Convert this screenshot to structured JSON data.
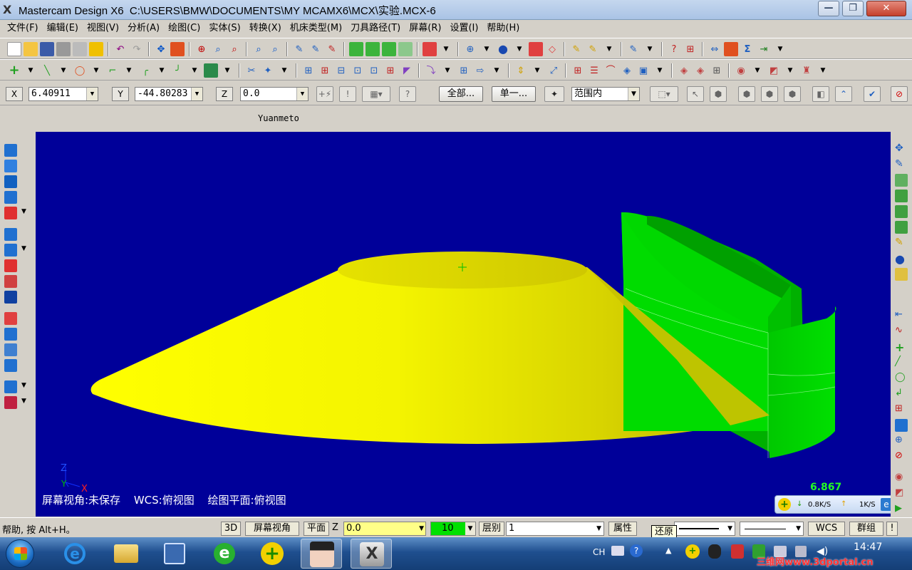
{
  "window": {
    "app_name": "Mastercam Design X6",
    "path": "C:\\USERS\\BMW\\DOCUMENTS\\MY MCAMX6\\MCX\\实验.MCX-6",
    "logo": "X"
  },
  "menu": [
    "文件(F)",
    "编辑(E)",
    "视图(V)",
    "分析(A)",
    "绘图(C)",
    "实体(S)",
    "转换(X)",
    "机床类型(M)",
    "刀具路径(T)",
    "屏幕(R)",
    "设置(I)",
    "帮助(H)"
  ],
  "coords": {
    "x_label": "X",
    "x_value": "6.40911",
    "y_label": "Y",
    "y_value": "-44.80283",
    "z_label": "Z",
    "z_value": "0.0",
    "btn_all": "全部...",
    "btn_single": "单一...",
    "range_select": "范围内"
  },
  "author": "Yuanmeto",
  "viewport": {
    "screen_view": "屏幕视角:未保存",
    "wcs": "WCS:俯视图",
    "cplane": "绘图平面:俯视图",
    "scale": "6.867",
    "axis_z": "Z",
    "axis_y": "Y",
    "axis_x": "X",
    "net_down": "0.8K/S",
    "net_up": "1K/S",
    "colors": {
      "background": "#000099",
      "cone": "#ffff00",
      "block": "#00dd00"
    }
  },
  "status": {
    "help": "帮助, 按 Alt+H。",
    "btn_3d": "3D",
    "btn_screen_view": "屏幕视角",
    "btn_plane": "平面",
    "z_label": "Z",
    "z_value": "0.0",
    "color_value": "10",
    "level_label": "层别",
    "level_value": "1",
    "btn_attr": "属性",
    "btn_wcs": "WCS",
    "btn_group": "群组",
    "btn_bang": "!",
    "tooltip": "还原"
  },
  "taskbar": {
    "lang": "CH",
    "clock": "14:47"
  },
  "watermark": "三维网www.3dportal.cn"
}
